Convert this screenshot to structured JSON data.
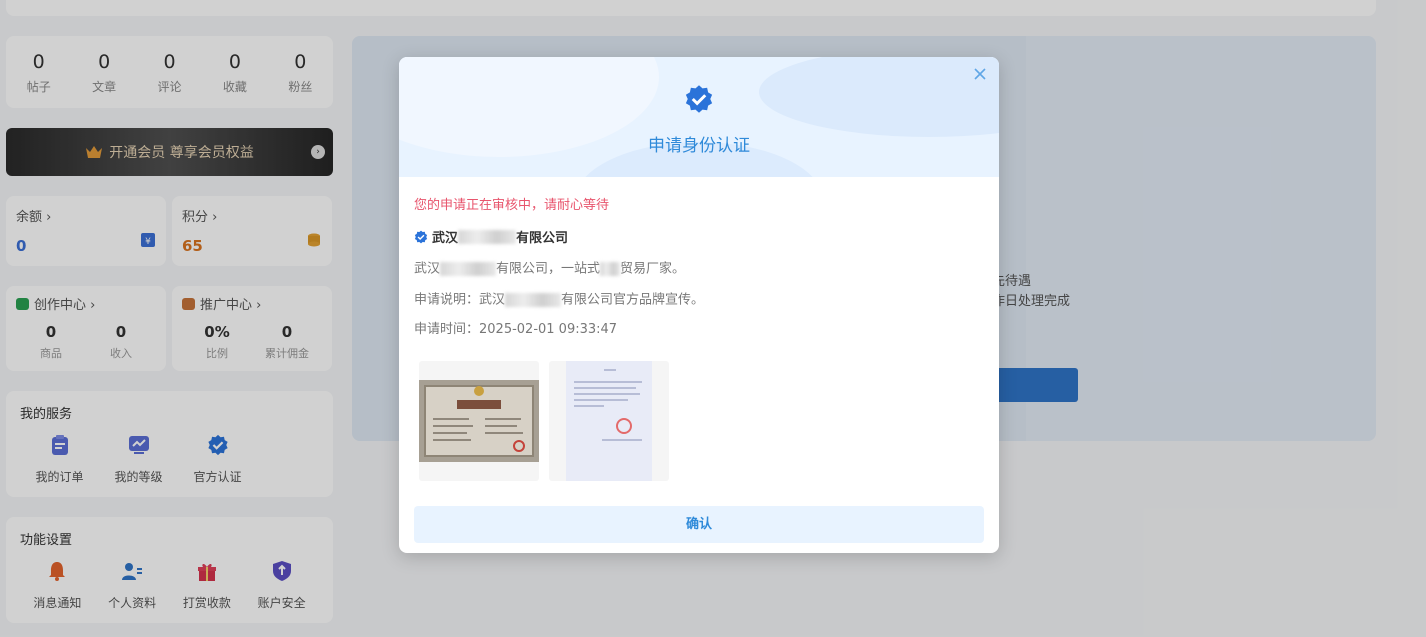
{
  "stats": [
    {
      "num": "0",
      "label": "帖子"
    },
    {
      "num": "0",
      "label": "文章"
    },
    {
      "num": "0",
      "label": "评论"
    },
    {
      "num": "0",
      "label": "收藏"
    },
    {
      "num": "0",
      "label": "粉丝"
    }
  ],
  "vip": {
    "label": "开通会员 尊享会员权益"
  },
  "wallet": {
    "balance": {
      "title": "余额 ›",
      "value": "0",
      "color": "#3b6fd6"
    },
    "points": {
      "title": "积分 ›",
      "value": "65",
      "color": "#d9731f"
    }
  },
  "creation": {
    "title": "创作中心 ›",
    "items": [
      {
        "n": "0",
        "l": "商品"
      },
      {
        "n": "0",
        "l": "收入"
      }
    ]
  },
  "promotion": {
    "title": "推广中心 ›",
    "items": [
      {
        "n": "0%",
        "l": "比例"
      },
      {
        "n": "0",
        "l": "累计佣金"
      }
    ]
  },
  "services": {
    "title": "我的服务",
    "items": [
      "我的订单",
      "我的等级",
      "官方认证"
    ]
  },
  "settings": {
    "title": "功能设置",
    "items": [
      "消息通知",
      "个人资料",
      "打赏收款",
      "账户安全"
    ]
  },
  "background_text": {
    "line1": "先待遇",
    "line2": "作日处理完成"
  },
  "modal": {
    "title": "申请身份认证",
    "status": "您的申请正在审核中，请耐心等待",
    "company_prefix": "武汉",
    "company_suffix": "有限公司",
    "desc_prefix": "武汉",
    "desc_mid": "有限公司，一站式",
    "desc_suffix": "贸易厂家。",
    "note_prefix": "申请说明：武汉",
    "note_suffix": "有限公司官方品牌宣传。",
    "time": "申请时间：2025-02-01 09:33:47",
    "confirm_label": "确认"
  },
  "colors": {
    "accent": "#2f8ad9",
    "status": "#e8556d"
  }
}
